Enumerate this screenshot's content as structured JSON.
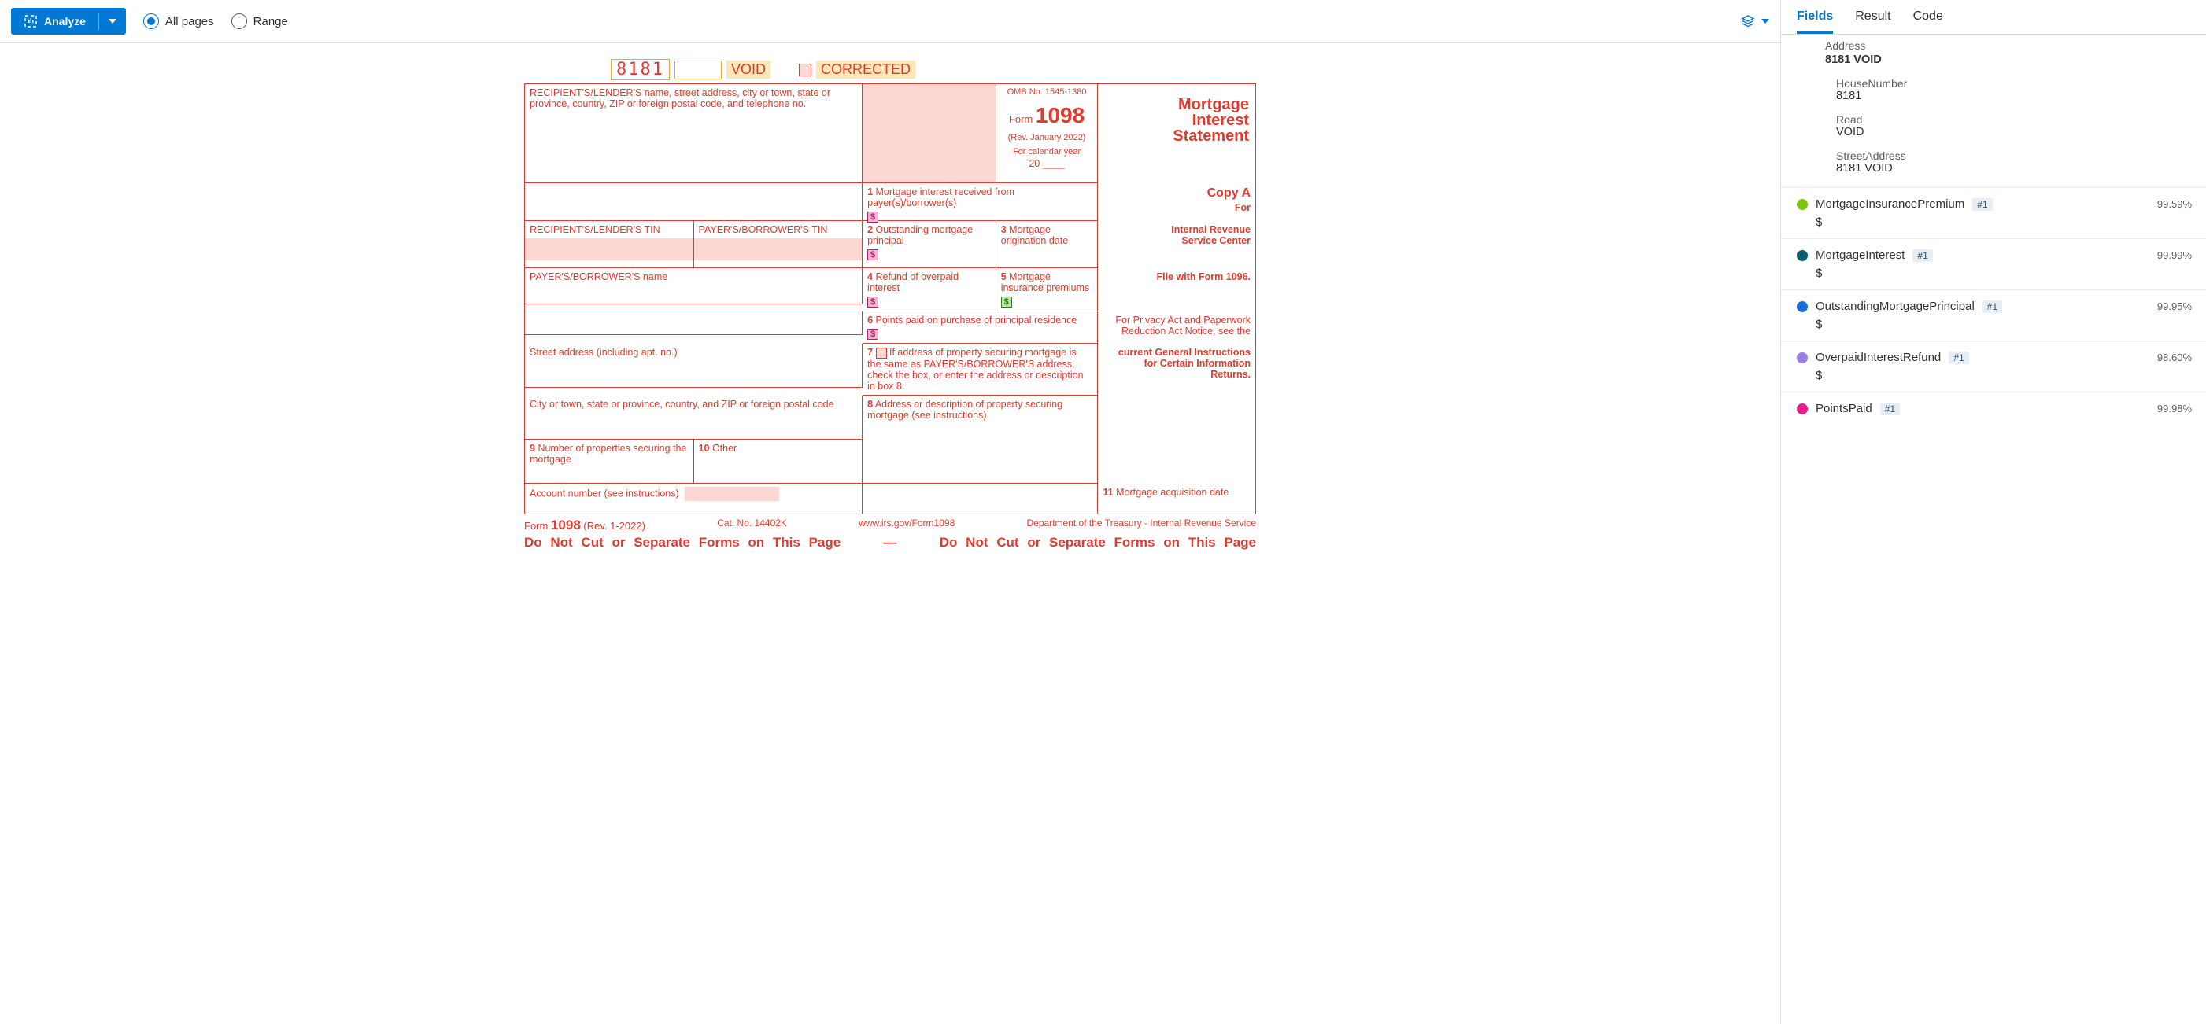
{
  "toolbar": {
    "analyze": "Analyze",
    "allPages": "All pages",
    "range": "Range"
  },
  "form": {
    "topNumber": "8181",
    "void": "VOID",
    "corrected": "CORRECTED",
    "recipientLenderLabel": "RECIPIENT'S/LENDER'S name, street address, city or town, state or province, country, ZIP or foreign postal code, and telephone no.",
    "omb": "OMB No. 1545-1380",
    "formWord": "Form",
    "formNumber": "1098",
    "rev": "(Rev. January 2022)",
    "calYear": "For calendar year",
    "year20": "20",
    "title1": "Mortgage",
    "title2": "Interest",
    "title3": "Statement",
    "box1": "Mortgage interest received from payer(s)/borrower(s)",
    "recipientTin": "RECIPIENT'S/LENDER'S TIN",
    "payerTin": "PAYER'S/BORROWER'S TIN",
    "box2": "Outstanding mortgage principal",
    "box3": "Mortgage origination date",
    "box4": "Refund of overpaid interest",
    "box5": "Mortgage insurance premiums",
    "box6": "Points paid on purchase of principal residence",
    "payerName": "PAYER'S/BORROWER'S name",
    "street": "Street address (including apt. no.)",
    "box7": "If address of property securing mortgage is the same as PAYER'S/BORROWER'S address, check the box, or enter the address or description in box 8.",
    "city": "City or town, state or province, country, and ZIP or foreign postal code",
    "box8": "Address or description of property securing mortgage (see instructions)",
    "box9": "Number of properties securing the mortgage",
    "box10": "Other",
    "box11": "Mortgage acquisition date",
    "account": "Account number (see instructions)",
    "copyA": "Copy A",
    "copyAFor": "For",
    "copyAIrs1": "Internal Revenue",
    "copyAIrs2": "Service Center",
    "fileWith": "File with Form 1096.",
    "privacy": "For Privacy Act and Paperwork Reduction Act Notice, see the",
    "privacy2": "current General Instructions for Certain Information Returns.",
    "footerForm": "Form",
    "footer1098": "1098",
    "footerRev": "(Rev. 1-2022)",
    "catNo": "Cat. No. 14402K",
    "irsUrl": "www.irs.gov/Form1098",
    "dept": "Department of the Treasury - Internal Revenue Service",
    "noCut": "Do Not Cut or Separate Forms on This Page",
    "dash": "—"
  },
  "tabs": {
    "fields": "Fields",
    "result": "Result",
    "code": "Code"
  },
  "address": {
    "title": "Address",
    "value": "8181 VOID",
    "houseNumberK": "HouseNumber",
    "houseNumberV": "8181",
    "roadK": "Road",
    "roadV": "VOID",
    "streetK": "StreetAddress",
    "streetV": "8181 VOID"
  },
  "fields": [
    {
      "color": "#7cc50b",
      "name": "MortgageInsurancePremium",
      "badge": "#1",
      "conf": "99.59%",
      "value": "$"
    },
    {
      "color": "#0b5e6b",
      "name": "MortgageInterest",
      "badge": "#1",
      "conf": "99.99%",
      "value": "$"
    },
    {
      "color": "#1a6fd6",
      "name": "OutstandingMortgagePrincipal",
      "badge": "#1",
      "conf": "99.95%",
      "value": "$"
    },
    {
      "color": "#9b7de8",
      "name": "OverpaidInterestRefund",
      "badge": "#1",
      "conf": "98.60%",
      "value": "$"
    },
    {
      "color": "#e81b8a",
      "name": "PointsPaid",
      "badge": "#1",
      "conf": "99.98%",
      "value": ""
    }
  ]
}
